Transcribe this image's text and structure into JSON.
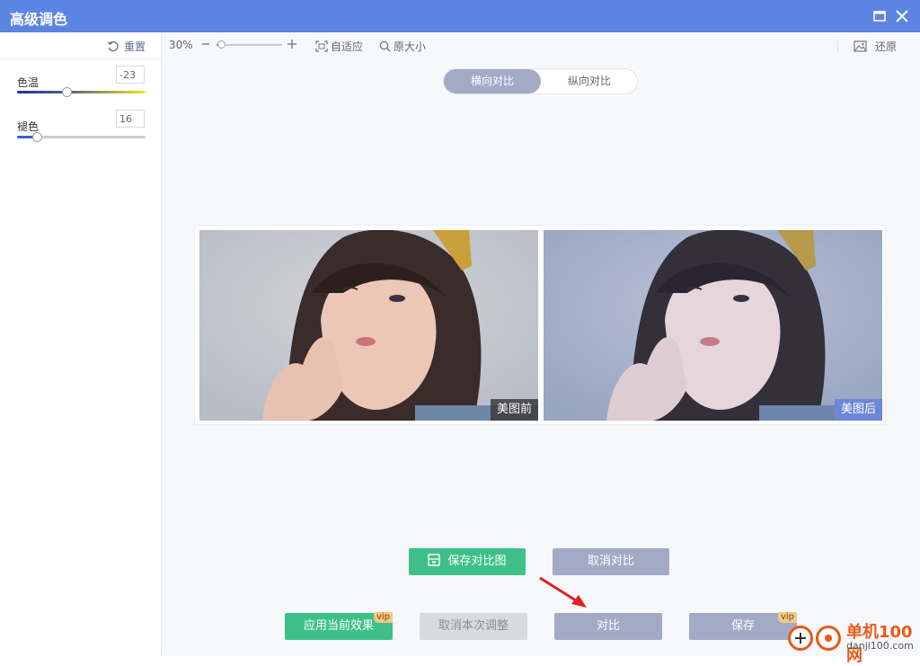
{
  "window": {
    "title": "高级调色",
    "maximize_icon": "maximize-icon",
    "close_icon": "close-icon"
  },
  "sidebar": {
    "reset_label": "重置",
    "sliders": [
      {
        "label": "色温",
        "value": "-23",
        "level": 0.39
      },
      {
        "label": "褪色",
        "value": "16",
        "level": 0.16
      }
    ]
  },
  "toolbar": {
    "zoom": "30%",
    "zoom_level": 0.08,
    "fit_label": "自适应",
    "original_size_label": "原大小",
    "restore_label": "还原"
  },
  "compare_mode": {
    "horizontal": "横向对比",
    "vertical": "纵向对比",
    "selected": "横向对比"
  },
  "preview": {
    "before_label": "美图前",
    "after_label": "美图后"
  },
  "actions": {
    "save_compare": "保存对比图",
    "cancel_compare": "取消对比",
    "apply_current": "应用当前效果",
    "cancel_adjust": "取消本次调整",
    "compare": "对比",
    "save": "保存",
    "vip": "vip"
  },
  "watermark": {
    "brand": "单机100网",
    "domain": "danji100.com"
  },
  "colors": {
    "titlebar": "#5b84e3",
    "green_button": "#3ec189",
    "gray_button": "#a3aac6",
    "vip_badge": "#f3c886",
    "annotation_arrow": "#e02020"
  }
}
